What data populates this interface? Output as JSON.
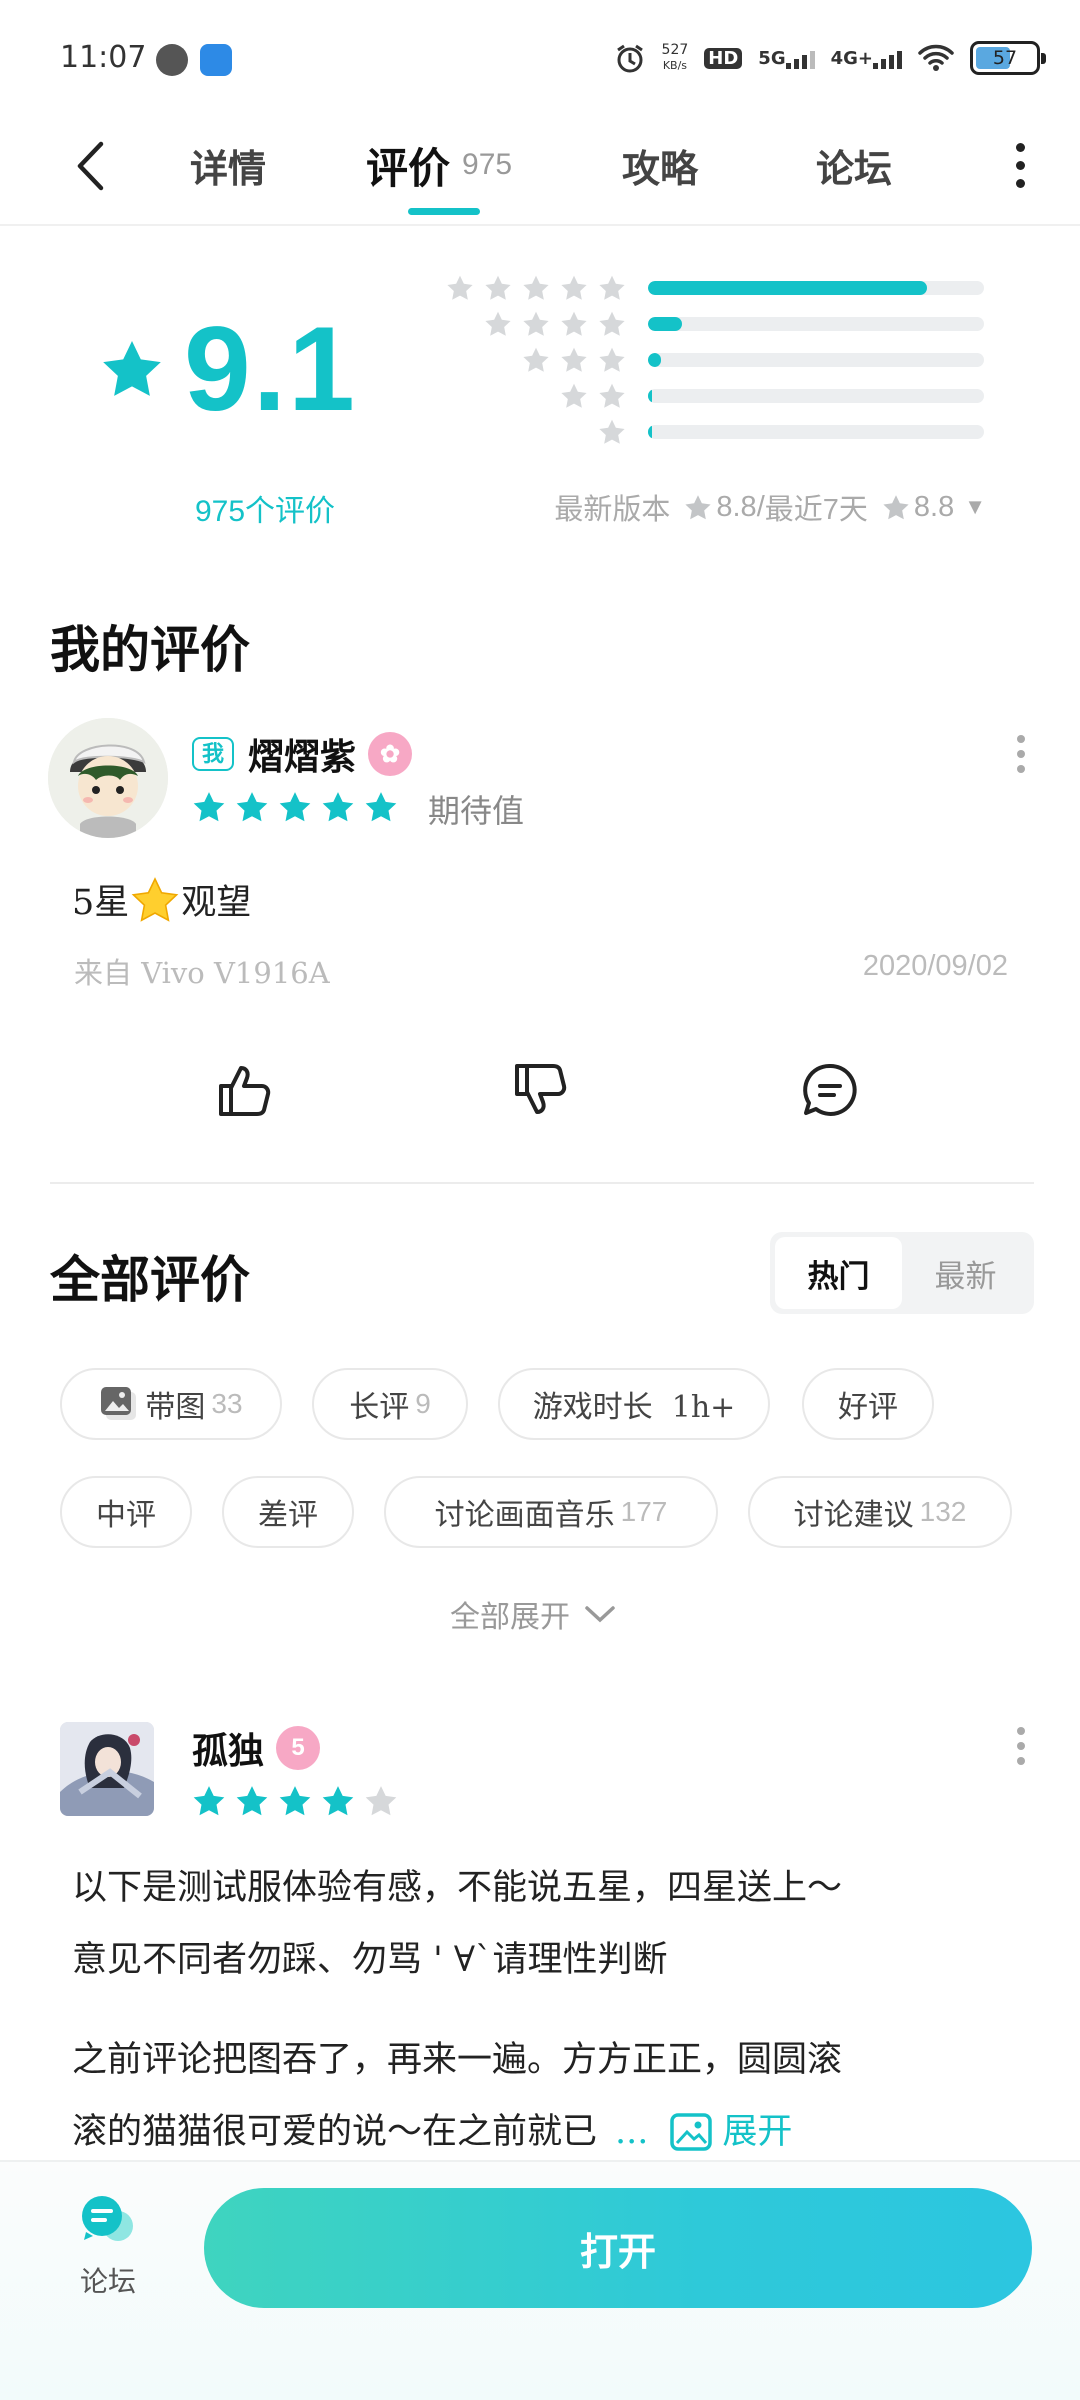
{
  "status_bar": {
    "time": "11:07",
    "net_speed_value": "527",
    "net_speed_unit": "KB/s",
    "hd_label": "HD",
    "net_5g": "5G",
    "net_4g": "4G+",
    "battery": "57"
  },
  "tabs": {
    "details": "详情",
    "reviews": "评价",
    "reviews_count": "975",
    "guides": "攻略",
    "forum": "论坛"
  },
  "summary": {
    "score": "9.1",
    "review_count_text": "975个评价",
    "latest_version_label": "最新版本",
    "latest_version_score": "8.8",
    "separator": "/",
    "recent_label": "最近7天",
    "recent_score": "8.8",
    "distribution": [
      {
        "stars": 5,
        "fraction": 0.83
      },
      {
        "stars": 4,
        "fraction": 0.1
      },
      {
        "stars": 3,
        "fraction": 0.04
      },
      {
        "stars": 2,
        "fraction": 0.01
      },
      {
        "stars": 1,
        "fraction": 0.01
      }
    ]
  },
  "my_review": {
    "section_title": "我的评价",
    "me_badge": "我",
    "username": "熠熠紫",
    "rating": 5,
    "tag": "期待值",
    "text_prefix": "5星",
    "text_suffix": "观望",
    "device": "来自 Vivo V1916A",
    "date": "2020/09/02"
  },
  "all_reviews": {
    "section_title": "全部评价",
    "sort_hot": "热门",
    "sort_new": "最新",
    "filters": [
      {
        "label": "带图",
        "count": "33"
      },
      {
        "label": "长评",
        "count": "9"
      },
      {
        "label": "游戏时长  1h+",
        "count": ""
      },
      {
        "label": "好评",
        "count": ""
      },
      {
        "label": "中评",
        "count": ""
      },
      {
        "label": "差评",
        "count": ""
      },
      {
        "label": "讨论画面音乐",
        "count": "177"
      },
      {
        "label": "讨论建议",
        "count": "132"
      }
    ],
    "expand_all": "全部展开"
  },
  "post": {
    "username": "孤独",
    "level": "5",
    "rating": 4,
    "line1": "以下是测试服体验有感，不能说五星，四星送上～",
    "line2": "意见不同者勿踩、勿骂 ' ∀`请理性判断",
    "line3": "之前评论把图吞了，再来一遍。方方正正，圆圆滚",
    "line4": "滚的猫猫很可爱的说～在之前就已",
    "ellipsis": "...",
    "expand": "展开"
  },
  "bottom_bar": {
    "forum_label": "论坛",
    "open_button": "打开"
  },
  "colors": {
    "accent": "#14c2c8",
    "star_inactive": "#d6d8da",
    "bar_track": "#eceef0"
  }
}
